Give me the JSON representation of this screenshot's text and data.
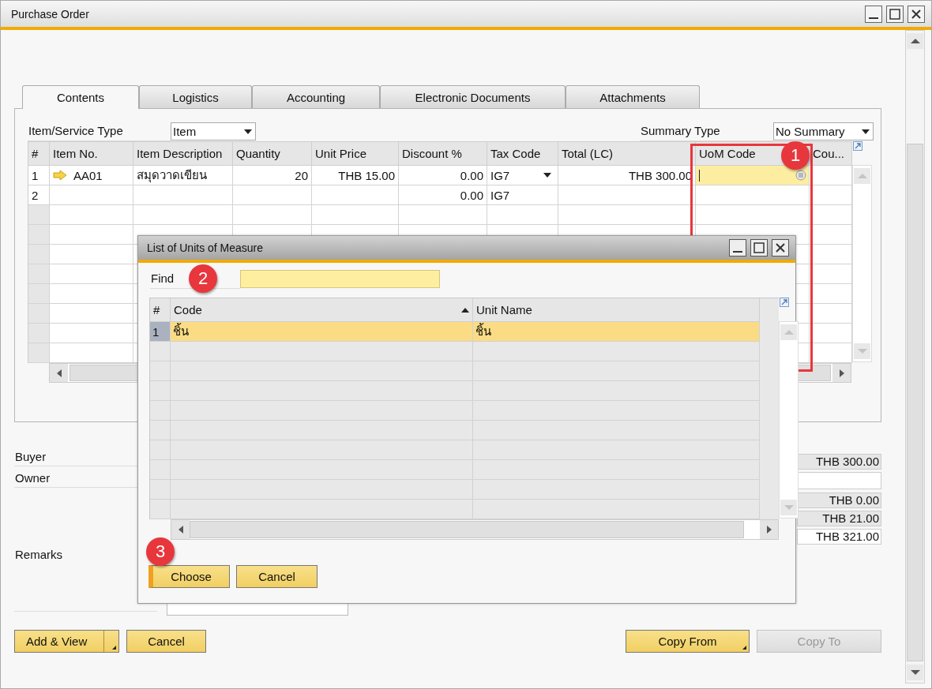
{
  "window": {
    "title": "Purchase Order"
  },
  "tabs": [
    {
      "label": "Contents",
      "selected": true
    },
    {
      "label": "Logistics",
      "selected": false
    },
    {
      "label": "Accounting",
      "selected": false
    },
    {
      "label": "Electronic Documents",
      "selected": false
    },
    {
      "label": "Attachments",
      "selected": false
    }
  ],
  "item_service_type": {
    "label": "Item/Service Type",
    "value": "Item"
  },
  "summary_type": {
    "label": "Summary Type",
    "value": "No Summary"
  },
  "table": {
    "columns": [
      "#",
      "Item No.",
      "Item Description",
      "Quantity",
      "Unit Price",
      "Discount %",
      "Tax Code",
      "Total (LC)",
      "UoM Code",
      "Cou..."
    ],
    "rows": [
      {
        "no": "1",
        "item_no": "AA01",
        "description": "สมุดวาดเขียน",
        "quantity": "20",
        "unit_price": "THB 15.00",
        "discount": "0.00",
        "tax_code": "IG7",
        "total": "THB 300.00",
        "active": true
      },
      {
        "no": "2",
        "discount": "0.00",
        "tax_code": "IG7",
        "active": false
      }
    ]
  },
  "footer_fields": [
    {
      "label": "Buyer"
    },
    {
      "label": "Owner"
    },
    {
      "label": "Remarks"
    }
  ],
  "totals": [
    {
      "value": "THB 300.00",
      "editable": false
    },
    {
      "editable": true
    },
    {
      "value": "THB 0.00",
      "editable": false
    },
    {
      "value": "THB 21.00",
      "editable": false
    },
    {
      "value": "THB 321.00",
      "editable": true
    }
  ],
  "buttons": [
    {
      "label": "Add & View",
      "kind": "split",
      "disabled": false
    },
    {
      "label": "Cancel",
      "kind": "plain",
      "disabled": false
    },
    {
      "label": "Copy From",
      "kind": "menu",
      "disabled": false
    },
    {
      "label": "Copy To",
      "kind": "plain",
      "disabled": true
    }
  ],
  "dialog": {
    "title": "List of Units of Measure",
    "find": {
      "label": "Find"
    },
    "columns": [
      {
        "label": "#",
        "sorted": false
      },
      {
        "label": "Code",
        "sorted": true
      },
      {
        "label": "Unit Name",
        "sorted": false
      }
    ],
    "rows": [
      {
        "no": "1",
        "code": "ชิ้น",
        "name": "ชิ้น",
        "selected": true
      }
    ],
    "buttons": [
      {
        "label": "Choose",
        "default": true
      },
      {
        "label": "Cancel",
        "default": false
      }
    ]
  },
  "callouts": [
    {
      "number": "1"
    },
    {
      "number": "2"
    },
    {
      "number": "3"
    }
  ]
}
